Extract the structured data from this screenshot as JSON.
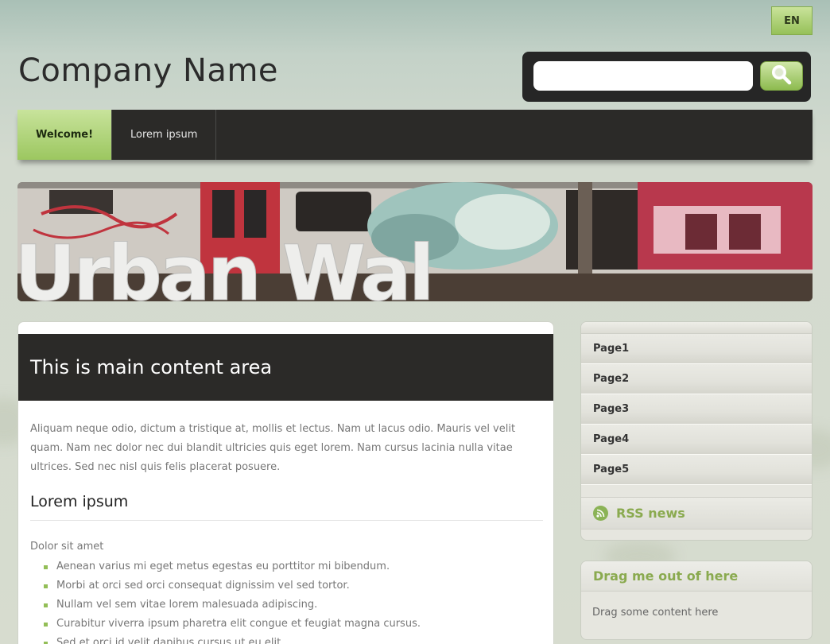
{
  "header": {
    "language": "EN",
    "company_name": "Company Name",
    "search": {
      "value": "",
      "placeholder": "",
      "button_icon": "search-icon"
    }
  },
  "nav": {
    "items": [
      {
        "label": "Welcome!",
        "active": true
      },
      {
        "label": "Lorem ipsum",
        "active": false
      }
    ]
  },
  "banner": {
    "title": "Urban Wall"
  },
  "main": {
    "title": "This is main content area",
    "paragraph": "Aliquam neque odio, dictum a tristique at, mollis et lectus. Nam ut lacus odio. Mauris vel velit quam. Nam nec dolor nec dui blandit ultricies quis eget lorem. Nam cursus lacinia nulla vitae ultrices. Sed nec nisl quis felis placerat posuere.",
    "subheading": "Lorem ipsum",
    "intro": "Dolor sit amet",
    "list": [
      "Aenean varius mi eget metus egestas eu porttitor mi bibendum.",
      "Morbi at orci sed orci consequat dignissim vel sed tortor.",
      "Nullam vel sem vitae lorem malesuada adipiscing.",
      "Curabitur viverra ipsum pharetra elit congue et feugiat magna cursus.",
      "Sed et orci id velit dapibus cursus ut eu elit."
    ]
  },
  "sidebar": {
    "pages": [
      "Page1",
      "Page2",
      "Page3",
      "Page4",
      "Page5"
    ],
    "rss_label": "RSS news"
  },
  "drag_box": {
    "title": "Drag me out of here",
    "body": "Drag some content here"
  },
  "colors": {
    "accent_green": "#9cc760",
    "dark_bar": "#2b2a28",
    "heading_green": "#8aaa4f"
  }
}
